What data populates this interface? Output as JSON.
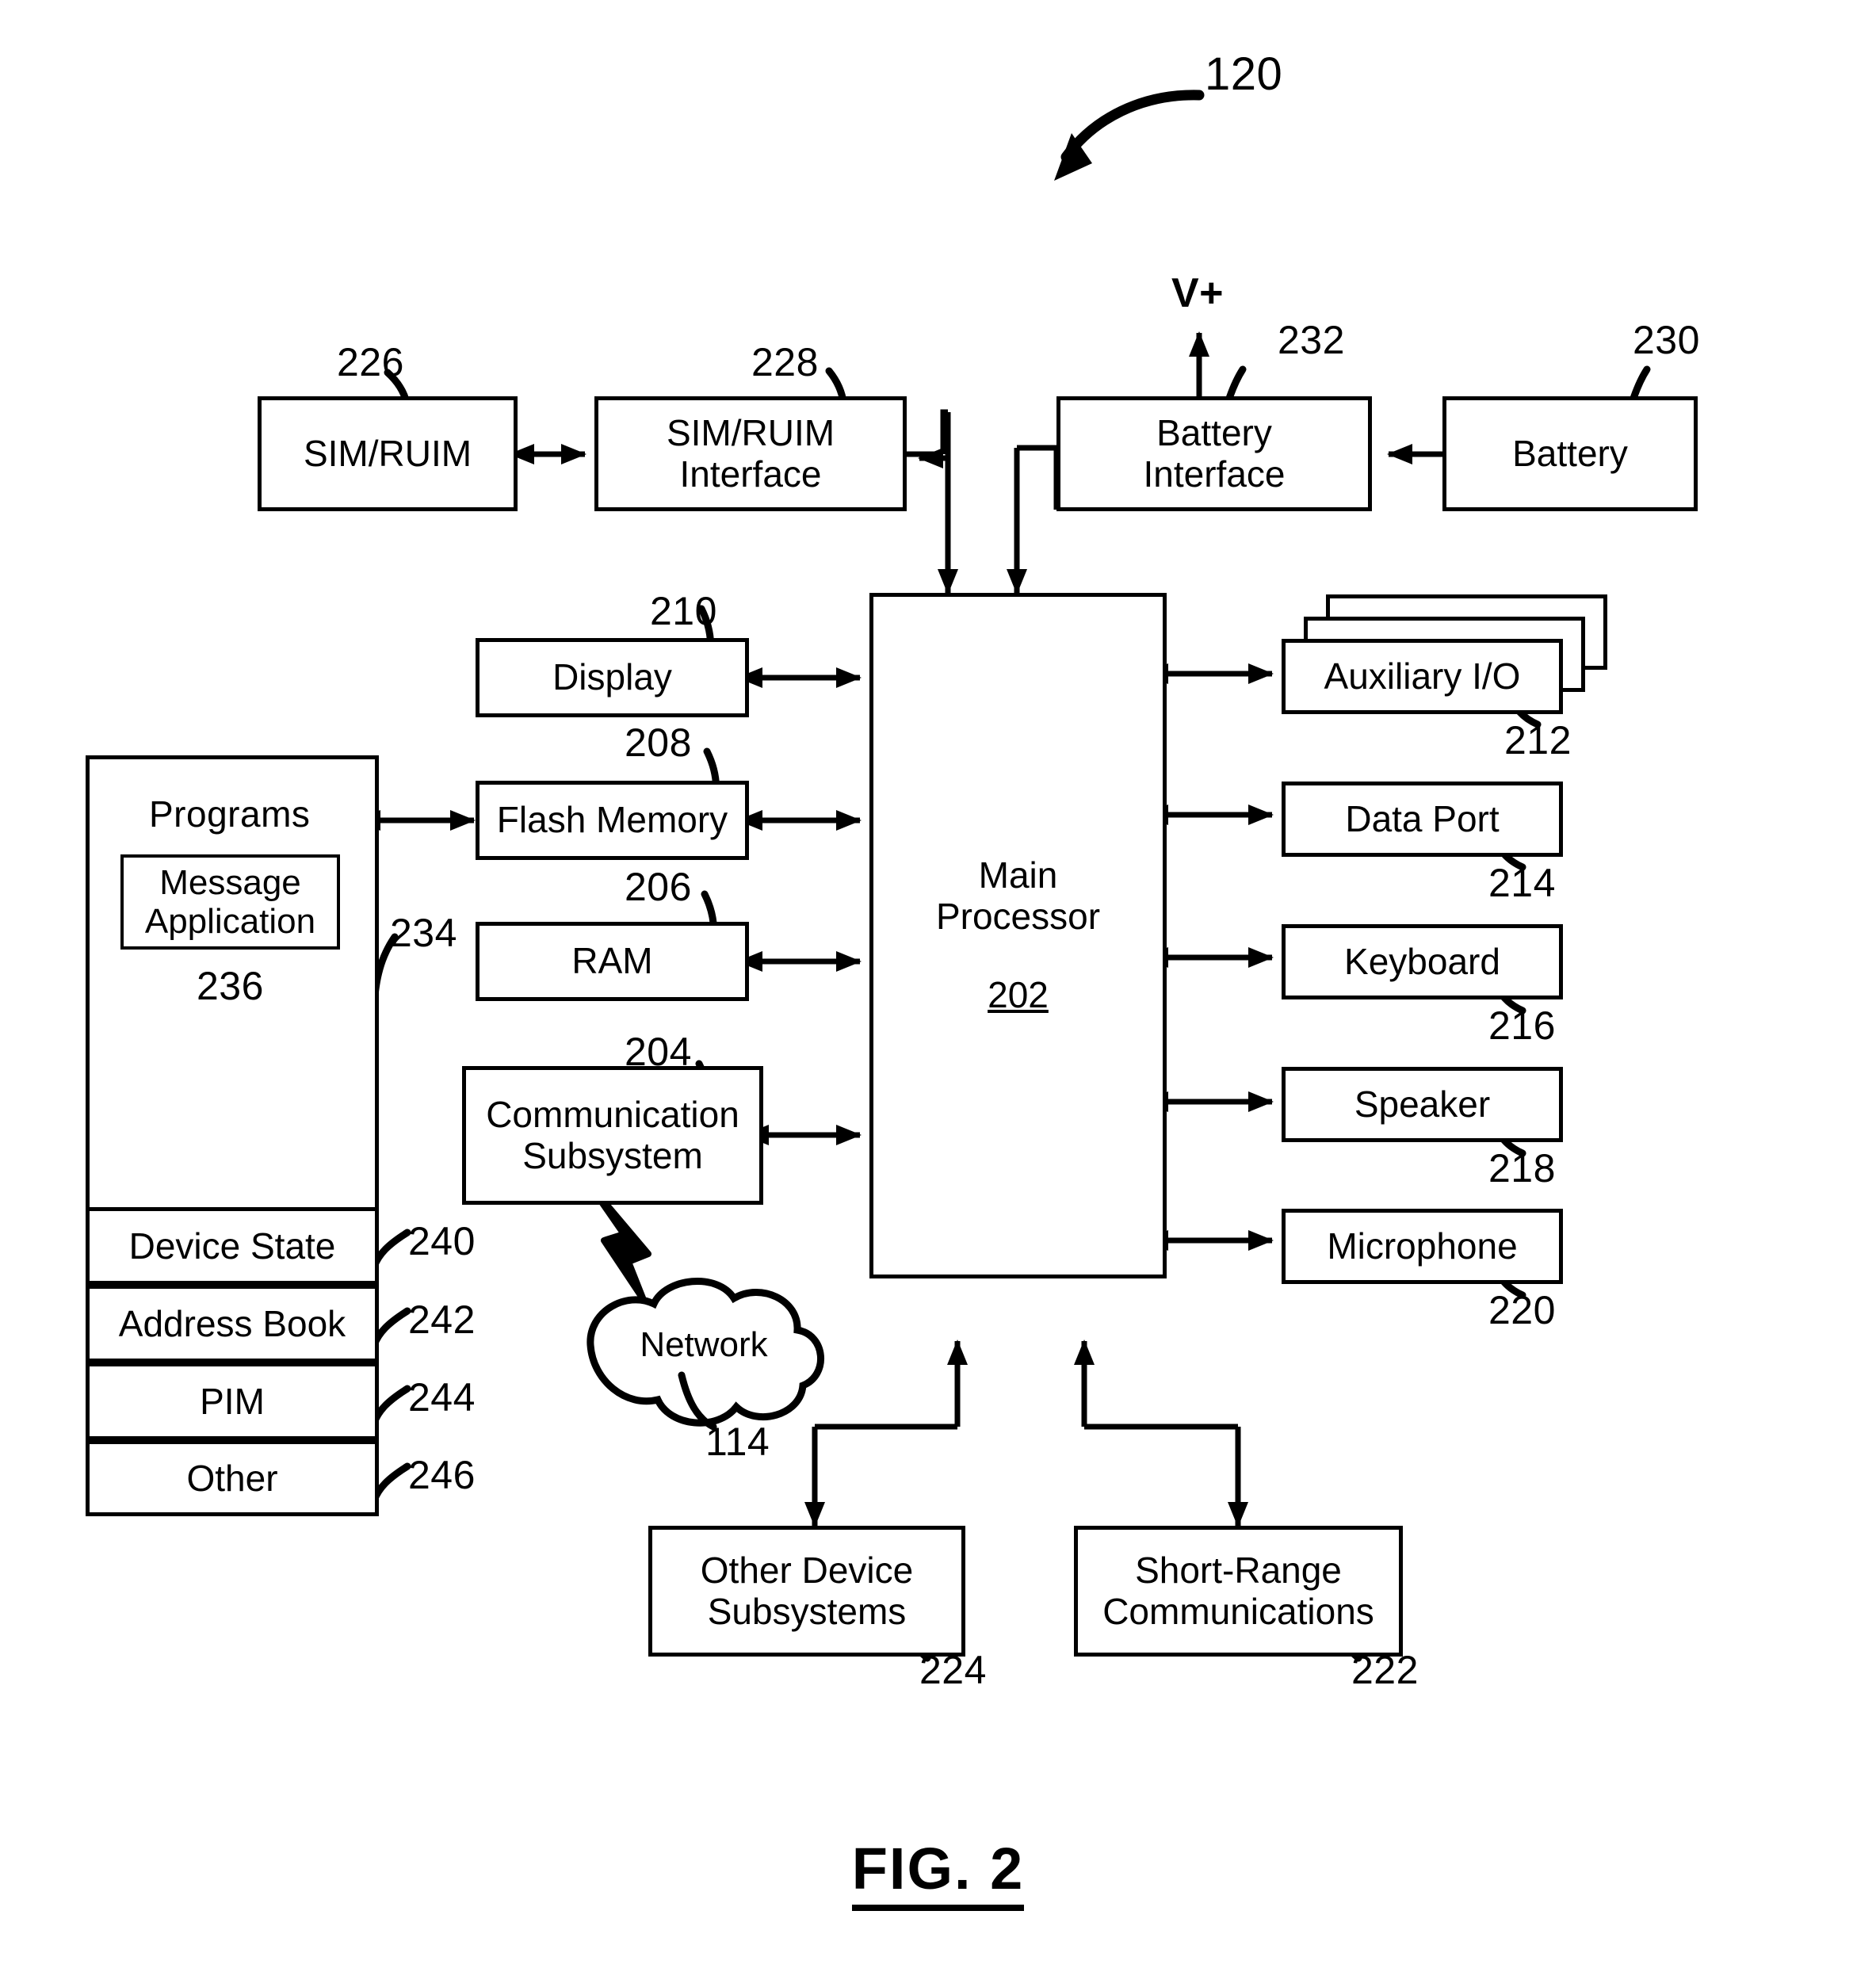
{
  "figure": {
    "caption": "FIG. 2",
    "top_reference": "120"
  },
  "power": {
    "v_plus_label": "V+"
  },
  "blocks": {
    "sim_ruim": {
      "label": "SIM/RUIM",
      "ref": "226"
    },
    "sim_ruim_interface": {
      "label": "SIM/RUIM\nInterface",
      "line1": "SIM/RUIM",
      "line2": "Interface",
      "ref": "228"
    },
    "battery_interface": {
      "line1": "Battery",
      "line2": "Interface",
      "ref": "232"
    },
    "battery": {
      "label": "Battery",
      "ref": "230"
    },
    "display": {
      "label": "Display",
      "ref": "210"
    },
    "flash_memory": {
      "label": "Flash Memory",
      "ref": "208"
    },
    "ram": {
      "label": "RAM",
      "ref": "206"
    },
    "communication_subsystem": {
      "line1": "Communication",
      "line2": "Subsystem",
      "ref": "204"
    },
    "main_processor": {
      "line1": "Main",
      "line2": "Processor",
      "ref": "202"
    },
    "auxiliary_io": {
      "label": "Auxiliary I/O",
      "ref": "212"
    },
    "data_port": {
      "label": "Data Port",
      "ref": "214"
    },
    "keyboard": {
      "label": "Keyboard",
      "ref": "216"
    },
    "speaker": {
      "label": "Speaker",
      "ref": "218"
    },
    "microphone": {
      "label": "Microphone",
      "ref": "220"
    },
    "other_device_subsystems": {
      "line1": "Other Device",
      "line2": "Subsystems",
      "ref": "224"
    },
    "short_range_communications": {
      "line1": "Short-Range",
      "line2": "Communications",
      "ref": "222"
    },
    "network": {
      "label": "Network",
      "ref": "114"
    }
  },
  "memory": {
    "programs": {
      "label": "Programs",
      "ref": "234"
    },
    "message_application": {
      "line1": "Message",
      "line2": "Application",
      "ref": "236"
    },
    "rows": [
      {
        "label": "Device State",
        "ref": "240"
      },
      {
        "label": "Address Book",
        "ref": "242"
      },
      {
        "label": "PIM",
        "ref": "244"
      },
      {
        "label": "Other",
        "ref": "246"
      }
    ]
  },
  "colors": {
    "stroke": "#000000",
    "background": "#ffffff"
  }
}
